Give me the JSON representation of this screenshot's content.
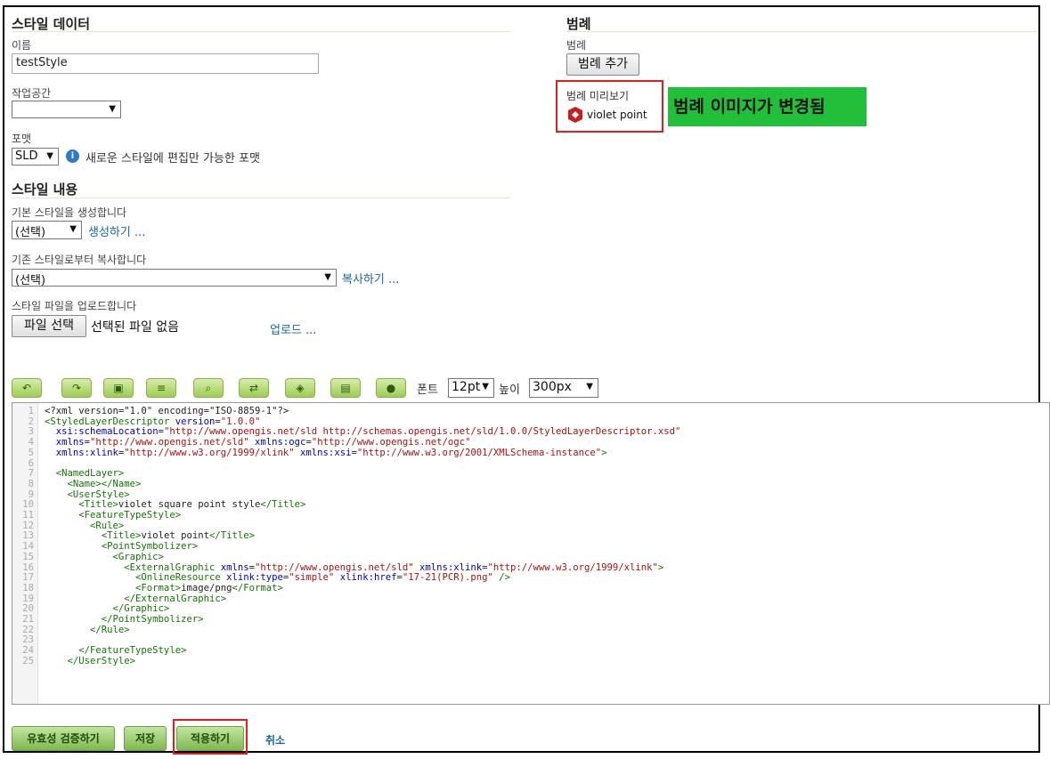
{
  "left": {
    "style_data_heading": "스타일 데이터",
    "name_label": "이름",
    "name_value": "testStyle",
    "workspace_label": "작업공간",
    "workspace_value": "",
    "format_label": "포맷",
    "format_value": "SLD",
    "format_info": "새로운 스타일에 편집만 가능한 포맷",
    "style_content_heading": "스타일 내용",
    "generate_label": "기본 스타일을 생성합니다",
    "generate_select": "(선택)",
    "generate_link": "생성하기 ...",
    "copy_label": "기존 스타일로부터 복사합니다",
    "copy_select": "(선택)",
    "copy_link": "복사하기 ...",
    "upload_label": "스타일 파일을 업로드합니다",
    "file_button": "파일 선택",
    "file_status": "선택된 파일 없음",
    "upload_link": "업로드 ..."
  },
  "right": {
    "legend_heading": "범례",
    "legend_label": "범례",
    "add_legend_button": "범례 추가",
    "preview_label": "범례 미리보기",
    "preview_item": "violet point",
    "callout": "범례 이미지가 변경됨",
    "callout_color": "#22c03a"
  },
  "toolbar": {
    "icons": [
      "undo-icon",
      "redo-icon",
      "go-to-line-icon",
      "reformat-icon",
      "find-icon",
      "replace-icon",
      "graphics-icon",
      "image-icon",
      "color-picker-icon"
    ],
    "font_label": "폰트",
    "font_value": "12pt",
    "height_label": "높이",
    "height_value": "300px"
  },
  "editor": {
    "line_numbers": [
      "1",
      "2",
      "3",
      "4",
      "5",
      "6",
      "7",
      "8",
      "9",
      "10",
      "11",
      "12",
      "13",
      "14",
      "15",
      "16",
      "17",
      "18",
      "19",
      "20",
      "21",
      "22",
      "23",
      "24",
      "25"
    ]
  },
  "footer": {
    "validate_button": "유효성 검증하기",
    "save_button": "저장",
    "apply_button": "적용하기",
    "cancel_link": "취소"
  },
  "colors": {
    "highlight_box": "#e02020",
    "button_green": "#9ccd55",
    "link": "#1a66a5"
  }
}
